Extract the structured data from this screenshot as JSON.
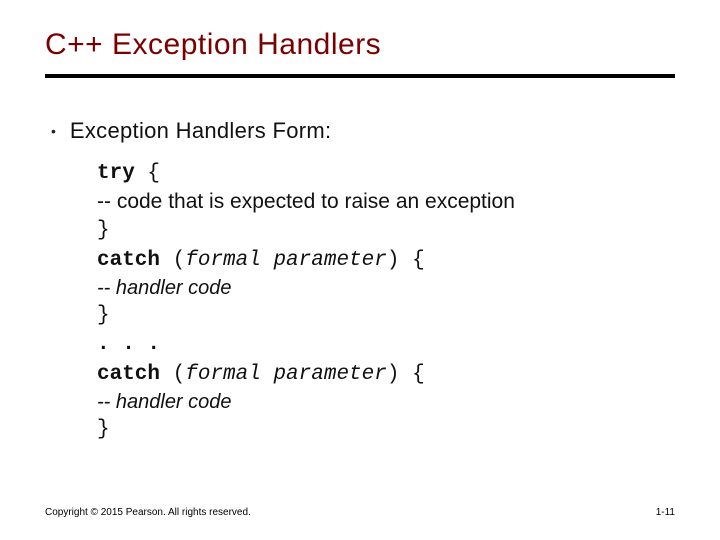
{
  "title": "C++ Exception Handlers",
  "bullet": "Exception Handlers Form:",
  "code": {
    "try_kw": "try",
    "try_brace": " {",
    "try_comment": "-- code that is expected to raise an exception",
    "close_brace": "}",
    "catch_kw": "catch",
    "paren_open": " (",
    "formal_param": "formal parameter",
    "paren_close_brace": ")  {",
    "handler_comment": "-- handler code",
    "ellipsis": ". . ."
  },
  "footer": {
    "copyright": "Copyright © 2015 Pearson. All rights reserved.",
    "page": "1-11"
  }
}
